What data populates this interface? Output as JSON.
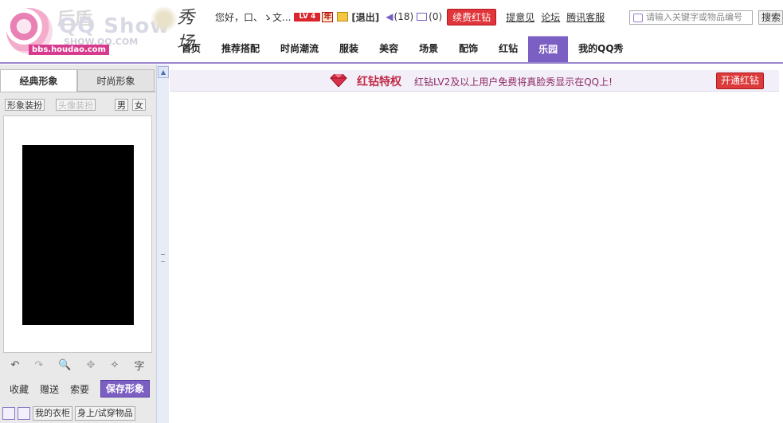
{
  "logo": {
    "main": "QQ Show",
    "sub": "SHOW.QQ.COM",
    "bbs": "bbs.houdao.com",
    "watermark": "后盾",
    "brush": "秀场"
  },
  "user": {
    "greeting": "您好，口、ゝ文...",
    "level": "LV 4",
    "year_badge": "年",
    "logout": "[退出]",
    "speaker_count": "(18)",
    "msg_count": "(0)",
    "renew_button": "续费红钻"
  },
  "toplinks": [
    "提意见",
    "论坛",
    "腾讯客服"
  ],
  "search": {
    "placeholder": "请输入关键字或物品编号",
    "button": "搜索"
  },
  "nav": [
    {
      "label": "首页"
    },
    {
      "label": "推荐搭配"
    },
    {
      "label": "时尚潮流"
    },
    {
      "label": "服装"
    },
    {
      "label": "美容"
    },
    {
      "label": "场景"
    },
    {
      "label": "配饰"
    },
    {
      "label": "红钻"
    },
    {
      "label": "乐园",
      "active": true
    },
    {
      "label": "我的QQ秀"
    }
  ],
  "left": {
    "tab_active": "经典形象",
    "tab_inactive": "时尚形象",
    "sub_buttons": {
      "image_dress": "形象装扮",
      "head_dress": "头像装扮",
      "male": "男",
      "female": "女"
    },
    "tools": {
      "undo": "↶",
      "redo": "↷",
      "zoom": "🔍",
      "move": "✥",
      "wand": "✧",
      "text": "字"
    },
    "actions": {
      "collect": "收藏",
      "gift": "赠送",
      "request": "索要",
      "save": "保存形象"
    },
    "bottom": {
      "wardrobe": "我的衣柜",
      "trying": "身上/试穿物品"
    }
  },
  "banner": {
    "title": "红钻特权",
    "desc": "红钻LV2及以上用户免费将真脸秀显示在QQ上!",
    "button": "开通红钻"
  },
  "colors": {
    "accent": "#7c5fc3",
    "red": "#e0363b",
    "banner_bg": "#f3eff8"
  }
}
